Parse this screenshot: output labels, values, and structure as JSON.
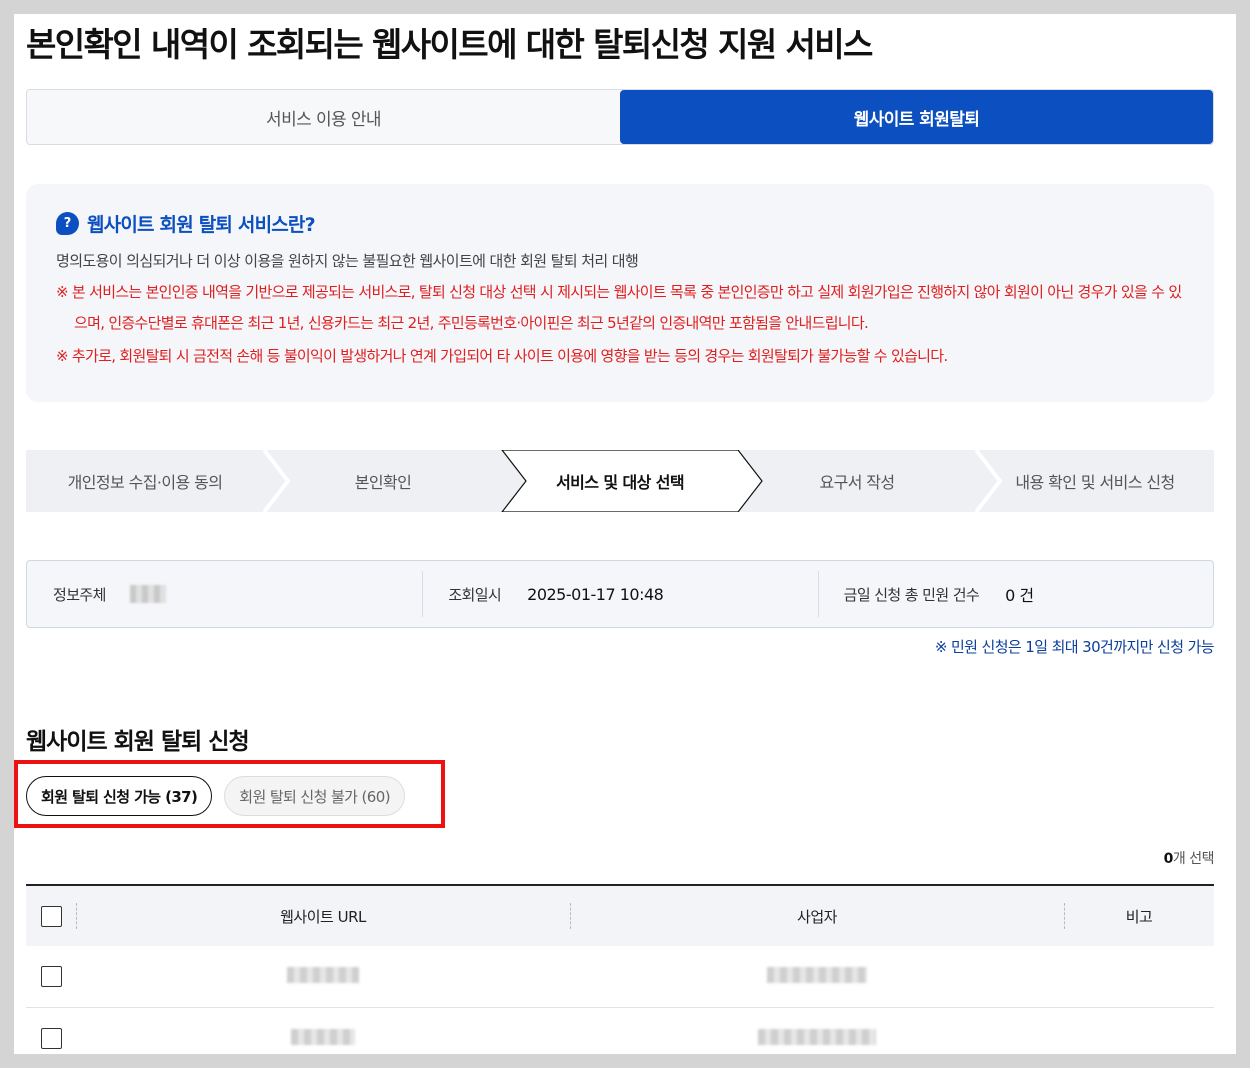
{
  "page_title": "본인확인 내역이 조회되는 웹사이트에 대한 탈퇴신청 지원 서비스",
  "tabs": [
    {
      "label": "서비스 이용 안내",
      "active": false
    },
    {
      "label": "웹사이트 회원탈퇴",
      "active": true
    }
  ],
  "info": {
    "icon": "question-bubble-icon",
    "icon_glyph": "?",
    "title": "웹사이트 회원 탈퇴 서비스란?",
    "description": "명의도용이 의심되거나 더 이상 이용을 원하지 않는 불필요한 웹사이트에 대한 회원 탈퇴 처리 대행",
    "notice_1": "※ 본 서비스는 본인인증 내역을 기반으로 제공되는 서비스로, 탈퇴 신청 대상 선택 시 제시되는 웹사이트 목록 중 본인인증만 하고 실제 회원가입은 진행하지 않아 회원이 아닌 경우가 있을 수 있으며, 인증수단별로 휴대폰은 최근 1년, 신용카드는 최근 2년, 주민등록번호·아이핀은 최근 5년같의 인증내역만 포함됨을 안내드립니다.",
    "notice_2": "※ 추가로, 회원탈퇴 시 금전적 손해 등 불이익이 발생하거나 연계 가입되어 타 사이트 이용에 영향을 받는 등의 경우는 회원탈퇴가 불가능할 수 있습니다.",
    "notice_color": "#e01f1f"
  },
  "steps": [
    {
      "label": "개인정보 수집·이용 동의",
      "current": false
    },
    {
      "label": "본인확인",
      "current": false
    },
    {
      "label": "서비스 및 대상 선택",
      "current": true
    },
    {
      "label": "요구서 작성",
      "current": false
    },
    {
      "label": "내용 확인 및 서비스 신청",
      "current": false
    }
  ],
  "summary": {
    "subject_label": "정보주체",
    "query_time_label": "조회일시",
    "query_time_value": "2025-01-17 10:48",
    "today_count_label": "금일 신청 총 민원 건수",
    "today_count_value": "0 건"
  },
  "limit_note": "※ 민원 신청은 1일 최대 30건까지만 신청 가능",
  "section_title": "웹사이트 회원 탈퇴 신청",
  "filters": [
    {
      "label": "회원 탈퇴 신청 가능 (37)",
      "active": true
    },
    {
      "label": "회원 탈퇴 신청 불가 (60)",
      "active": false
    }
  ],
  "selection": {
    "count": "0",
    "suffix": "개 선택"
  },
  "table": {
    "headers": {
      "url": "웹사이트 URL",
      "business": "사업자",
      "note": "비고"
    }
  },
  "colors": {
    "accent": "#0b4fc0",
    "highlight": "#ee1111"
  }
}
